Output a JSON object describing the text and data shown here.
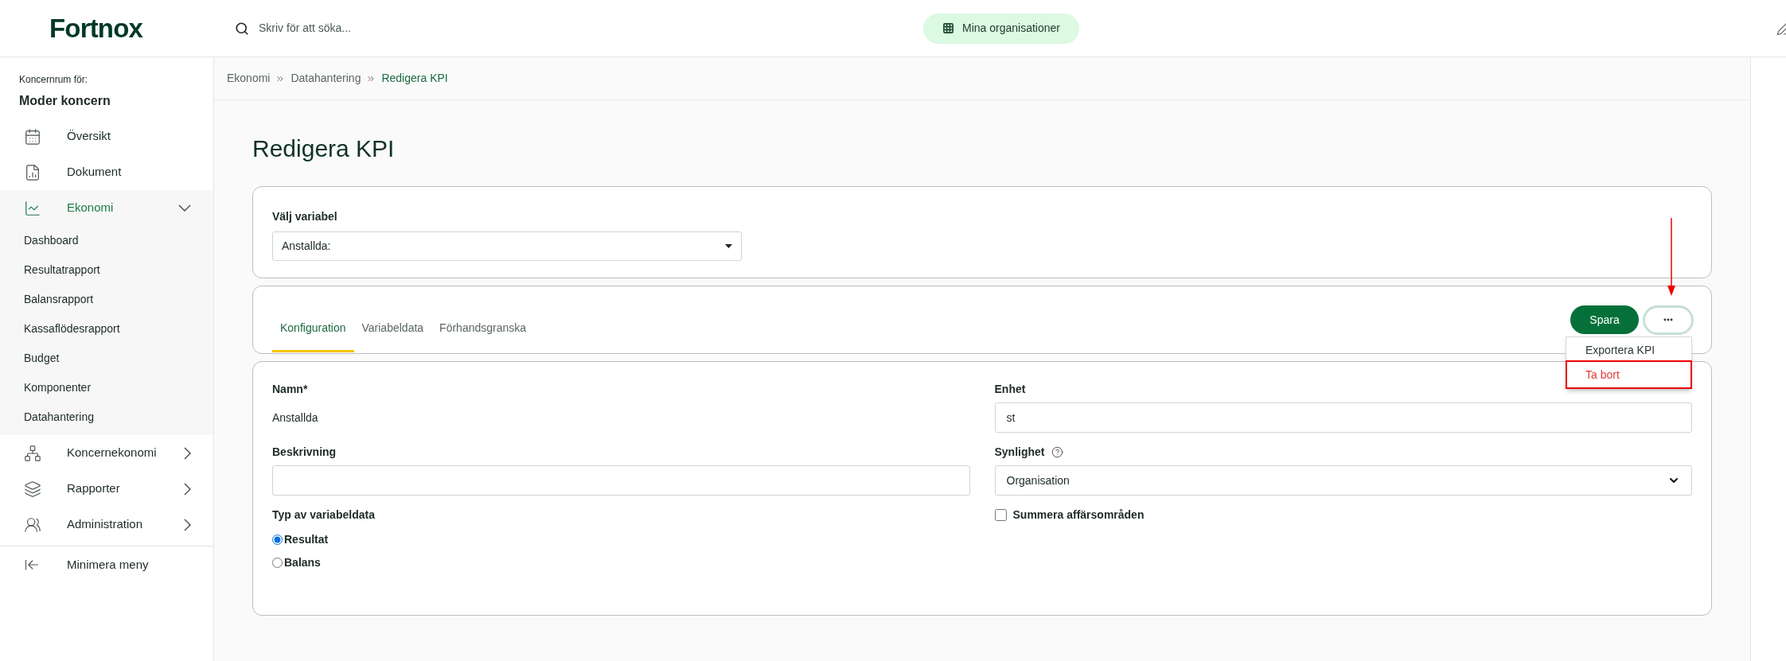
{
  "header": {
    "logo": "Fortnox",
    "search": {
      "placeholder": "Skriv för att söka..."
    },
    "org_button": "Mina organisationer"
  },
  "sidebar": {
    "context_label": "Koncernrum för:",
    "context_name": "Moder koncern",
    "items": [
      {
        "label": "Översikt",
        "kind": "link",
        "selected": false
      },
      {
        "label": "Dokument",
        "kind": "link",
        "selected": false
      },
      {
        "label": "Ekonomi",
        "kind": "group",
        "selected": true,
        "expanded": true,
        "children": [
          {
            "label": "Dashboard"
          },
          {
            "label": "Resultatrapport"
          },
          {
            "label": "Balansrapport"
          },
          {
            "label": "Kassaflödesrapport"
          },
          {
            "label": "Budget"
          },
          {
            "label": "Komponenter"
          },
          {
            "label": "Datahantering"
          }
        ]
      },
      {
        "label": "Koncernekonomi",
        "kind": "group",
        "selected": false,
        "expanded": false
      },
      {
        "label": "Rapporter",
        "kind": "group",
        "selected": false,
        "expanded": false
      },
      {
        "label": "Administration",
        "kind": "group",
        "selected": false,
        "expanded": false
      }
    ],
    "collapse": "Minimera meny"
  },
  "breadcrumb": [
    {
      "label": "Ekonomi",
      "current": false
    },
    {
      "label": "Datahantering",
      "current": false
    },
    {
      "label": "Redigera KPI",
      "current": true
    }
  ],
  "title": "Redigera KPI",
  "variable_select": {
    "label": "Välj variabel",
    "value": "Anstallda:"
  },
  "tabs": [
    {
      "label": "Konfiguration",
      "selected": true
    },
    {
      "label": "Variabeldata",
      "selected": false
    },
    {
      "label": "Förhandsgranska",
      "selected": false
    }
  ],
  "save_button": "Spara",
  "more_menu": {
    "open": true,
    "items": [
      {
        "label": "Exportera KPI",
        "kind": "normal",
        "annotated": false
      },
      {
        "label": "Ta bort",
        "kind": "danger",
        "annotated": true
      }
    ]
  },
  "annotation_arrow": true,
  "form": {
    "name": {
      "label": "Namn*",
      "value": "Anstallda"
    },
    "unit": {
      "label": "Enhet",
      "value": "st"
    },
    "description": {
      "label": "Beskrivning"
    },
    "visibility": {
      "label": "Synlighet",
      "value": "Organisation"
    },
    "data_type": {
      "label": "Typ av variabeldata",
      "options": [
        {
          "label": "Resultat",
          "selected": true
        },
        {
          "label": "Balans",
          "selected": false
        }
      ]
    },
    "sum_areas": {
      "label": "Summera affärsområden",
      "checked": false
    }
  }
}
